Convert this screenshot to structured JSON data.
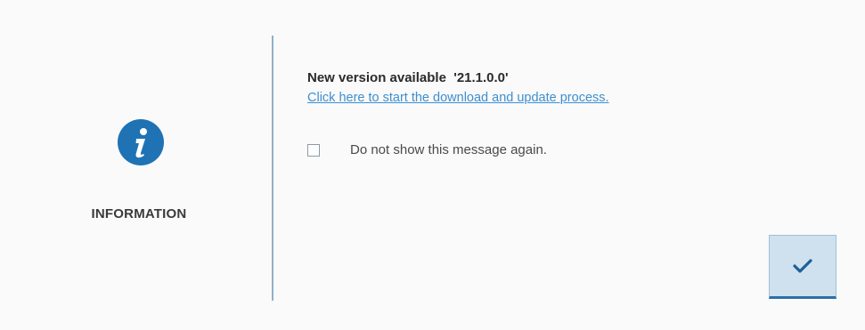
{
  "left_panel": {
    "icon": "info-icon",
    "label": "INFORMATION"
  },
  "message": {
    "version_text": "New version available  '21.1.0.0'",
    "update_link": "Click here to start the download and update process."
  },
  "option": {
    "checkbox_label": "Do not show this message again.",
    "checked": false
  },
  "actions": {
    "confirm_icon": "checkmark-icon"
  },
  "colors": {
    "accent": "#1f73b4",
    "link": "#3d8fd0",
    "divider": "#8fb0c9",
    "button_bg": "#cfe1ee",
    "button_border": "#2c6fa6",
    "background": "#fafafa"
  }
}
